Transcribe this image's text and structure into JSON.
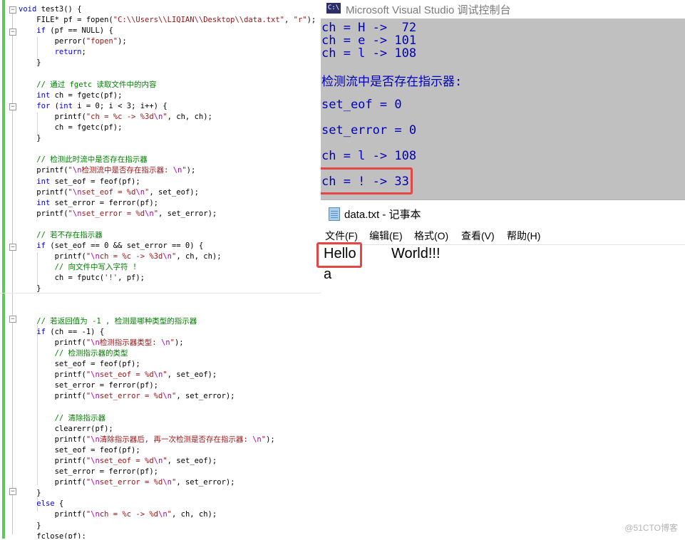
{
  "editor": {
    "lines": [
      [
        [
          "void",
          "kw"
        ],
        [
          " test3() {",
          ""
        ]
      ],
      [
        [
          "\tFILE* pf = fopen(",
          ""
        ],
        [
          "\"C:\\\\Users\\\\LIQIAN\\\\Desktop\\\\data.txt\"",
          "str"
        ],
        [
          ", ",
          ""
        ],
        [
          "\"r\"",
          "str"
        ],
        [
          ");",
          ""
        ]
      ],
      [
        [
          "\t",
          ""
        ],
        [
          "if",
          "kw"
        ],
        [
          " (pf == NULL) {",
          ""
        ]
      ],
      [
        [
          "\t\tperror(",
          ""
        ],
        [
          "\"fopen\"",
          "str"
        ],
        [
          ");",
          ""
        ]
      ],
      [
        [
          "\t\t",
          ""
        ],
        [
          "return",
          "kw"
        ],
        [
          ";",
          ""
        ]
      ],
      [
        [
          "\t}",
          ""
        ]
      ],
      [
        [
          "",
          ""
        ]
      ],
      [
        [
          "\t",
          ""
        ],
        [
          "// 通过 fgetc 读取文件中的内容",
          "cmt"
        ]
      ],
      [
        [
          "\t",
          ""
        ],
        [
          "int",
          "kw"
        ],
        [
          " ch = fgetc(pf);",
          ""
        ]
      ],
      [
        [
          "\t",
          ""
        ],
        [
          "for",
          "kw"
        ],
        [
          " (",
          ""
        ],
        [
          "int",
          "kw"
        ],
        [
          " i = 0; i < 3; i++) {",
          ""
        ]
      ],
      [
        [
          "\t\tprintf(",
          ""
        ],
        [
          "\"ch = %c -> %3d",
          "str"
        ],
        [
          "\\n",
          "esc"
        ],
        [
          "\"",
          "str"
        ],
        [
          ", ch, ch);",
          ""
        ]
      ],
      [
        [
          "\t\tch = fgetc(pf);",
          ""
        ]
      ],
      [
        [
          "\t}",
          ""
        ]
      ],
      [
        [
          "",
          ""
        ]
      ],
      [
        [
          "\t",
          ""
        ],
        [
          "// 检测此时流中是否存在指示器",
          "cmt"
        ]
      ],
      [
        [
          "\tprintf(",
          ""
        ],
        [
          "\"",
          "str"
        ],
        [
          "\\n",
          "esc"
        ],
        [
          "检测流中是否存在指示器: ",
          "str"
        ],
        [
          "\\n",
          "esc"
        ],
        [
          "\"",
          "str"
        ],
        [
          ");",
          ""
        ]
      ],
      [
        [
          "\t",
          ""
        ],
        [
          "int",
          "kw"
        ],
        [
          " set_eof = feof(pf);",
          ""
        ]
      ],
      [
        [
          "\tprintf(",
          ""
        ],
        [
          "\"",
          "str"
        ],
        [
          "\\n",
          "esc"
        ],
        [
          "set_eof = %d",
          "str"
        ],
        [
          "\\n",
          "esc"
        ],
        [
          "\"",
          "str"
        ],
        [
          ", set_eof);",
          ""
        ]
      ],
      [
        [
          "\t",
          ""
        ],
        [
          "int",
          "kw"
        ],
        [
          " set_error = ferror(pf);",
          ""
        ]
      ],
      [
        [
          "\tprintf(",
          ""
        ],
        [
          "\"",
          "str"
        ],
        [
          "\\n",
          "esc"
        ],
        [
          "set_error = %d",
          "str"
        ],
        [
          "\\n",
          "esc"
        ],
        [
          "\"",
          "str"
        ],
        [
          ", set_error);",
          ""
        ]
      ],
      [
        [
          "",
          ""
        ]
      ],
      [
        [
          "\t",
          ""
        ],
        [
          "// 若不存在指示器",
          "cmt"
        ]
      ],
      [
        [
          "\t",
          ""
        ],
        [
          "if",
          "kw"
        ],
        [
          " (set_eof == 0 && set_error == 0) {",
          ""
        ]
      ],
      [
        [
          "\t\tprintf(",
          ""
        ],
        [
          "\"",
          "str"
        ],
        [
          "\\n",
          "esc"
        ],
        [
          "ch = %c -> %3d",
          "str"
        ],
        [
          "\\n",
          "esc"
        ],
        [
          "\"",
          "str"
        ],
        [
          ", ch, ch);",
          ""
        ]
      ],
      [
        [
          "\t\t",
          ""
        ],
        [
          "// 向文件中写入字符 !",
          "cmt"
        ]
      ],
      [
        [
          "\t\tch = fputc(",
          ""
        ],
        [
          "'!'",
          "str"
        ],
        [
          ", pf);",
          ""
        ]
      ],
      [
        [
          "\t}",
          ""
        ]
      ],
      [
        [
          "",
          ""
        ]
      ],
      [
        [
          "",
          ""
        ]
      ],
      [
        [
          "\t",
          ""
        ],
        [
          "// 若返回值为 -1 , 检测是哪种类型的指示器",
          "cmt"
        ]
      ],
      [
        [
          "\t",
          ""
        ],
        [
          "if",
          "kw"
        ],
        [
          " (ch == -1) {",
          ""
        ]
      ],
      [
        [
          "\t\tprintf(",
          ""
        ],
        [
          "\"",
          "str"
        ],
        [
          "\\n",
          "esc"
        ],
        [
          "检测指示器类型: ",
          "str"
        ],
        [
          "\\n",
          "esc"
        ],
        [
          "\"",
          "str"
        ],
        [
          ");",
          ""
        ]
      ],
      [
        [
          "\t\t",
          ""
        ],
        [
          "// 检测指示器的类型",
          "cmt"
        ]
      ],
      [
        [
          "\t\tset_eof = feof(pf);",
          ""
        ]
      ],
      [
        [
          "\t\tprintf(",
          ""
        ],
        [
          "\"",
          "str"
        ],
        [
          "\\n",
          "esc"
        ],
        [
          "set_eof = %d",
          "str"
        ],
        [
          "\\n",
          "esc"
        ],
        [
          "\"",
          "str"
        ],
        [
          ", set_eof);",
          ""
        ]
      ],
      [
        [
          "\t\tset_error = ferror(pf);",
          ""
        ]
      ],
      [
        [
          "\t\tprintf(",
          ""
        ],
        [
          "\"",
          "str"
        ],
        [
          "\\n",
          "esc"
        ],
        [
          "set_error = %d",
          "str"
        ],
        [
          "\\n",
          "esc"
        ],
        [
          "\"",
          "str"
        ],
        [
          ", set_error);",
          ""
        ]
      ],
      [
        [
          "",
          ""
        ]
      ],
      [
        [
          "\t\t",
          ""
        ],
        [
          "// 清除指示器",
          "cmt"
        ]
      ],
      [
        [
          "\t\tclearerr(pf);",
          ""
        ]
      ],
      [
        [
          "\t\tprintf(",
          ""
        ],
        [
          "\"",
          "str"
        ],
        [
          "\\n",
          "esc"
        ],
        [
          "清除指示器后, 再一次检测是否存在指示器: ",
          "str"
        ],
        [
          "\\n",
          "esc"
        ],
        [
          "\"",
          "str"
        ],
        [
          ");",
          ""
        ]
      ],
      [
        [
          "\t\tset_eof = feof(pf);",
          ""
        ]
      ],
      [
        [
          "\t\tprintf(",
          ""
        ],
        [
          "\"",
          "str"
        ],
        [
          "\\n",
          "esc"
        ],
        [
          "set_eof = %d",
          "str"
        ],
        [
          "\\n",
          "esc"
        ],
        [
          "\"",
          "str"
        ],
        [
          ", set_eof);",
          ""
        ]
      ],
      [
        [
          "\t\tset_error = ferror(pf);",
          ""
        ]
      ],
      [
        [
          "\t\tprintf(",
          ""
        ],
        [
          "\"",
          "str"
        ],
        [
          "\\n",
          "esc"
        ],
        [
          "set_error = %d",
          "str"
        ],
        [
          "\\n",
          "esc"
        ],
        [
          "\"",
          "str"
        ],
        [
          ", set_error);",
          ""
        ]
      ],
      [
        [
          "\t}",
          ""
        ]
      ],
      [
        [
          "\t",
          ""
        ],
        [
          "else",
          "kw"
        ],
        [
          " {",
          ""
        ]
      ],
      [
        [
          "\t\tprintf(",
          ""
        ],
        [
          "\"",
          "str"
        ],
        [
          "\\n",
          "esc"
        ],
        [
          "ch = %c -> %d",
          "str"
        ],
        [
          "\\n",
          "esc"
        ],
        [
          "\"",
          "str"
        ],
        [
          ", ch, ch);",
          ""
        ]
      ],
      [
        [
          "\t}",
          ""
        ]
      ],
      [
        [
          "\tfclose(pf);",
          ""
        ]
      ],
      [
        [
          "}",
          ""
        ]
      ]
    ]
  },
  "console": {
    "icon_label": "C:\\",
    "title": "Microsoft Visual Studio 调试控制台",
    "lines": [
      "ch = H ->  72",
      "ch = e -> 101",
      "ch = l -> 108",
      "检测流中是否存在指示器:",
      "set_eof = 0",
      "set_error = 0",
      "ch = l -> 108",
      "ch = ! -> 33"
    ]
  },
  "notepad": {
    "title": "data.txt - 记事本",
    "menu": [
      "文件(F)",
      "编辑(E)",
      "格式(O)",
      "查看(V)",
      "帮助(H)"
    ],
    "line1_word1": "Hello",
    "line1_word2": "World!!!",
    "line2": "a"
  },
  "watermark": "@51CTO博客",
  "colors": {
    "console_text": "#0000b8",
    "console_bg": "#c0c0c0",
    "highlight": "#e64545",
    "gutter_change": "#5cc85c",
    "keyword": "#0000ff",
    "string": "#a31515",
    "comment": "#008000"
  }
}
